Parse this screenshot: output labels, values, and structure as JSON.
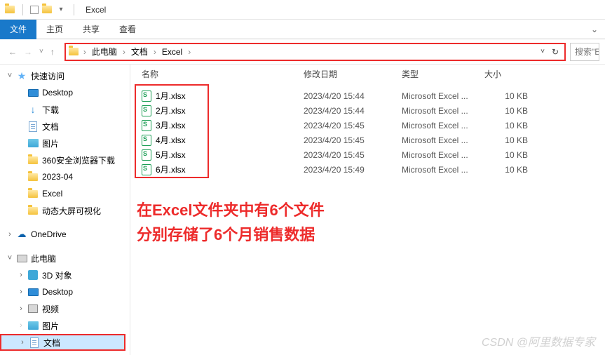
{
  "window": {
    "title": "Excel"
  },
  "ribbon": {
    "file": "文件",
    "home": "主页",
    "share": "共享",
    "view": "查看"
  },
  "breadcrumb": {
    "parts": [
      "此电脑",
      "文档",
      "Excel"
    ]
  },
  "search": {
    "placeholder": "搜索\"E"
  },
  "sidebar": {
    "quick_access": "快速访问",
    "desktop": "Desktop",
    "downloads": "下载",
    "documents": "文档",
    "pictures": "图片",
    "folder_360": "360安全浏览器下载",
    "folder_date": "2023-04",
    "folder_excel": "Excel",
    "folder_viz": "动态大屏可视化",
    "onedrive": "OneDrive",
    "this_pc": "此电脑",
    "objects_3d": "3D 对象",
    "pc_desktop": "Desktop",
    "videos": "视频",
    "pc_pictures": "图片",
    "pc_documents": "文档"
  },
  "columns": {
    "name": "名称",
    "date": "修改日期",
    "type": "类型",
    "size": "大小"
  },
  "files": [
    {
      "name": "1月.xlsx",
      "date": "2023/4/20 15:44",
      "type": "Microsoft Excel ...",
      "size": "10 KB"
    },
    {
      "name": "2月.xlsx",
      "date": "2023/4/20 15:44",
      "type": "Microsoft Excel ...",
      "size": "10 KB"
    },
    {
      "name": "3月.xlsx",
      "date": "2023/4/20 15:45",
      "type": "Microsoft Excel ...",
      "size": "10 KB"
    },
    {
      "name": "4月.xlsx",
      "date": "2023/4/20 15:45",
      "type": "Microsoft Excel ...",
      "size": "10 KB"
    },
    {
      "name": "5月.xlsx",
      "date": "2023/4/20 15:45",
      "type": "Microsoft Excel ...",
      "size": "10 KB"
    },
    {
      "name": "6月.xlsx",
      "date": "2023/4/20 15:49",
      "type": "Microsoft Excel ...",
      "size": "10 KB"
    }
  ],
  "annotation": {
    "line1": "在Excel文件夹中有6个文件",
    "line2": "分别存储了6个月销售数据"
  },
  "watermark": "CSDN @阿里数据专家"
}
